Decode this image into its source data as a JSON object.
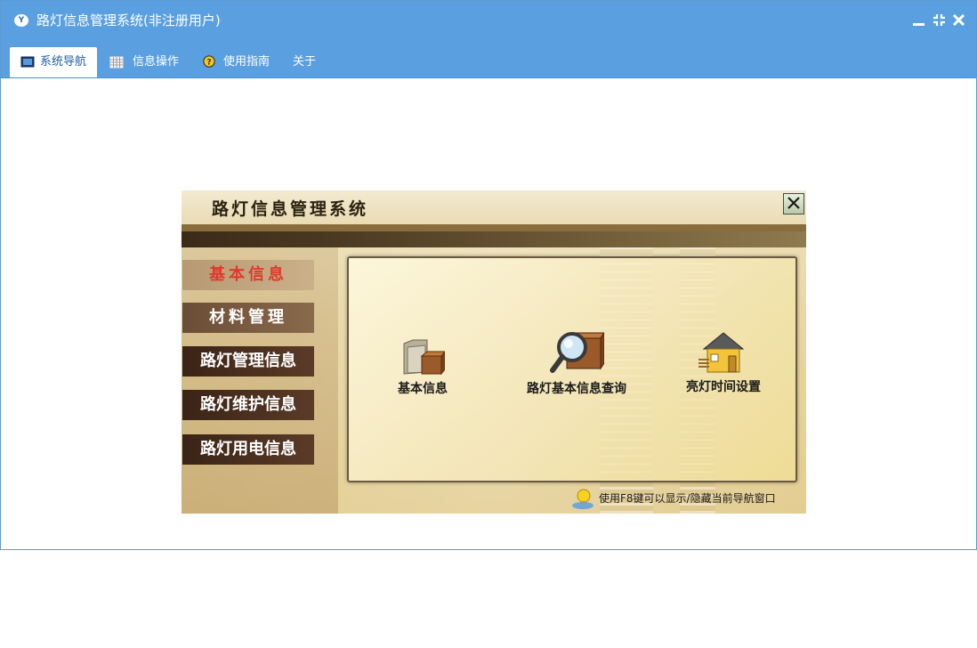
{
  "window": {
    "title": "路灯信息管理系统(非注册用户)",
    "logo_text": "Y"
  },
  "menu": {
    "tabs": [
      {
        "label": "系统导航",
        "icon": "monitor-icon",
        "active": true
      },
      {
        "label": "信息操作",
        "icon": "grid-icon",
        "active": false
      },
      {
        "label": "使用指南",
        "icon": "help-icon",
        "active": false
      },
      {
        "label": "关于",
        "icon": "",
        "active": false
      }
    ]
  },
  "panel": {
    "title": "路灯信息管理系统",
    "sidebar": [
      {
        "label": "基本信息",
        "active": true
      },
      {
        "label": "材料管理",
        "active": false
      },
      {
        "label": "路灯管理信息",
        "active": false
      },
      {
        "label": "路灯维护信息",
        "active": false
      },
      {
        "label": "路灯用电信息",
        "active": false
      }
    ],
    "functions": [
      {
        "label": "基本信息",
        "icon": "folder-box-icon"
      },
      {
        "label": "路灯基本信息查询",
        "icon": "magnifier-box-icon"
      },
      {
        "label": "亮灯时间设置",
        "icon": "house-icon"
      }
    ],
    "hint": "使用F8键可以显示/隐藏当前导航窗口"
  },
  "colors": {
    "titlebar": "#5aa0e0",
    "active_sidebar_text": "#e03a2c"
  }
}
